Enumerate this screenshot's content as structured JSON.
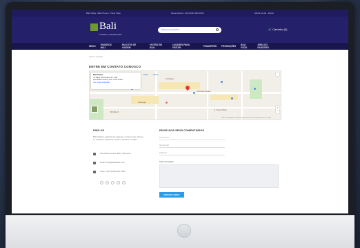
{
  "topbar": {
    "left": "Bali Vistas • Bali Phone • Travel Vista",
    "center": "Reservations: +62 (0)361 000 1000",
    "right_links": [
      "Minha Conta",
      "Entrar"
    ]
  },
  "header": {
    "logo_text": "Bali",
    "logo_sub": "TOURS & ADVENTURE",
    "search_placeholder": "Buscar produtos...",
    "cart_label": "Carrinho (0)"
  },
  "nav": {
    "items": [
      "INÍCIO",
      "PASSEIOS BALI",
      "PACOTES DE VIAGEM",
      "HOTÉIS EM BALI",
      "LUGARES PARA VISITAR",
      "TRANSFERS",
      "PROMOÇÕES",
      "BALI FOOD"
    ],
    "right": "ÁREA DO PARCEIRO"
  },
  "breadcrumb": "Início / Contato",
  "page_title": "ENTRE EM CONTATO CONOSCO",
  "map": {
    "card_title": "Bali Vistas",
    "card_lines": [
      "Jl. Raya Kerobokan No. 123,",
      "Kerobokan Kelod, Kec. Kuta Utara,",
      "Kabupaten Badung, Bali"
    ],
    "card_link": "Ver mapa ampliado",
    "directions": "Rotas",
    "save": "Salvar",
    "labels": [
      "Kerobokan",
      "Seminyak Square",
      "Jl. Sunset Road",
      "Petitenget",
      "Bali Beach"
    ],
    "footer": "Dados cartográficos ©2024 Google   Termos de Uso   Informar erro no mapa"
  },
  "find_us": {
    "heading": "FIND US",
    "description": "Bali Vistas é agência de viagens e turismo que oferece os melhores passeios, hotéis e pacotes em Bali.",
    "address": "Kerobokan Kelod, Bali, Indonesia",
    "email": "Email: info@balivistas.com",
    "phone": "Fone: +62 (0)361 000 1000"
  },
  "form": {
    "heading": "ENVIE-NOS SEUS COMENTÁRIOS",
    "fields": [
      "Seu Nome",
      "Seu Email",
      "Telefone"
    ],
    "message_label": "Sua mensagem",
    "submit_label": "ENVIAR AGORA"
  },
  "colors": {
    "header_bg": "#24206a",
    "nav_bg": "#19164e",
    "accent": "#2a9de6",
    "pin": "#e53935"
  }
}
